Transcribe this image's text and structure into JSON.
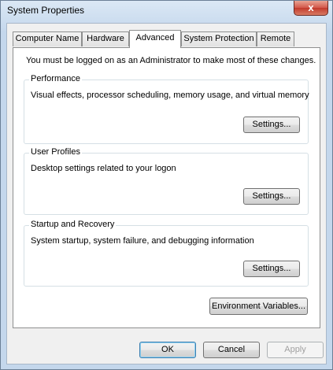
{
  "window": {
    "title": "System Properties",
    "close_glyph": "x"
  },
  "tabs": [
    {
      "label": "Computer Name"
    },
    {
      "label": "Hardware"
    },
    {
      "label": "Advanced"
    },
    {
      "label": "System Protection"
    },
    {
      "label": "Remote"
    }
  ],
  "notice": "You must be logged on as an Administrator to make most of these changes.",
  "performance": {
    "title": "Performance",
    "description": "Visual effects, processor scheduling, memory usage, and virtual memory",
    "button": "Settings..."
  },
  "user_profiles": {
    "title": "User Profiles",
    "description": "Desktop settings related to your logon",
    "button": "Settings..."
  },
  "startup_recovery": {
    "title": "Startup and Recovery",
    "description": "System startup, system failure, and debugging information",
    "button": "Settings..."
  },
  "env_button": "Environment Variables...",
  "footer": {
    "ok": "OK",
    "cancel": "Cancel",
    "apply": "Apply"
  }
}
